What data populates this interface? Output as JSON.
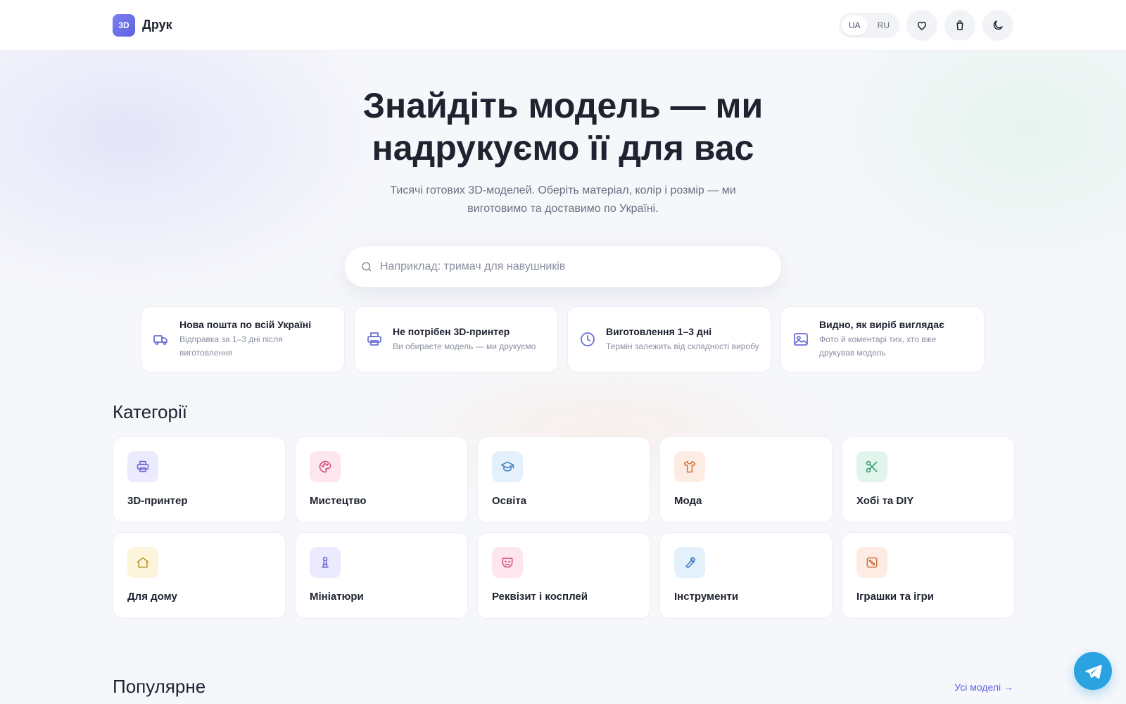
{
  "header": {
    "logo_badge": "3D",
    "logo_text": "Друк",
    "languages": [
      {
        "code": "UA",
        "active": true
      },
      {
        "code": "RU",
        "active": false
      }
    ],
    "icons": [
      "heart-icon",
      "bag-icon",
      "moon-icon"
    ]
  },
  "hero": {
    "title": "Знайдіть модель — ми надрукуємо її для вас",
    "subtitle": "Тисячі готових 3D-моделей. Оберіть матеріал, колір і розмір — ми виготовимо та доставимо по Україні.",
    "search_placeholder": "Наприклад: тримач для навушників"
  },
  "features": [
    {
      "icon": "truck-icon",
      "title": "Нова пошта по всій Україні",
      "desc": "Відправка за 1–3 дні після виготовлення"
    },
    {
      "icon": "printer-icon",
      "title": "Не потрібен 3D-принтер",
      "desc": "Ви обираєте модель — ми друкуємо"
    },
    {
      "icon": "clock-icon",
      "title": "Виготовлення 1–3 дні",
      "desc": "Термін залежить від складності виробу"
    },
    {
      "icon": "image-icon",
      "title": "Видно, як виріб виглядає",
      "desc": "Фото й коментарі тих, хто вже друкував модель"
    }
  ],
  "categories": {
    "title": "Категорії",
    "items": [
      {
        "label": "3D-принтер",
        "icon": "printer-icon",
        "bg": "#eceafd",
        "color": "#6b63d6"
      },
      {
        "label": "Мистецтво",
        "icon": "palette-icon",
        "bg": "#fde6ee",
        "color": "#d04a7a"
      },
      {
        "label": "Освіта",
        "icon": "graduation-cap-icon",
        "bg": "#e4f0fb",
        "color": "#3a7cc0"
      },
      {
        "label": "Мода",
        "icon": "shirt-icon",
        "bg": "#fdece4",
        "color": "#d0703a"
      },
      {
        "label": "Хобі та DIY",
        "icon": "scissors-icon",
        "bg": "#e2f5ec",
        "color": "#2f9a66"
      },
      {
        "label": "Для дому",
        "icon": "home-icon",
        "bg": "#fdf4dc",
        "color": "#b8901f"
      },
      {
        "label": "Мініатюри",
        "icon": "miniature-icon",
        "bg": "#eceafd",
        "color": "#6b63d6"
      },
      {
        "label": "Реквізит і косплей",
        "icon": "mask-icon",
        "bg": "#fde6ee",
        "color": "#d04a7a"
      },
      {
        "label": "Інструменти",
        "icon": "wrench-icon",
        "bg": "#e4f0fb",
        "color": "#3a7cc0"
      },
      {
        "label": "Іграшки та ігри",
        "icon": "dice-icon",
        "bg": "#fdece4",
        "color": "#d0703a"
      }
    ]
  },
  "popular": {
    "title": "Популярне",
    "all_link": "Усі моделі →"
  },
  "floating": {
    "icon": "telegram-icon"
  }
}
